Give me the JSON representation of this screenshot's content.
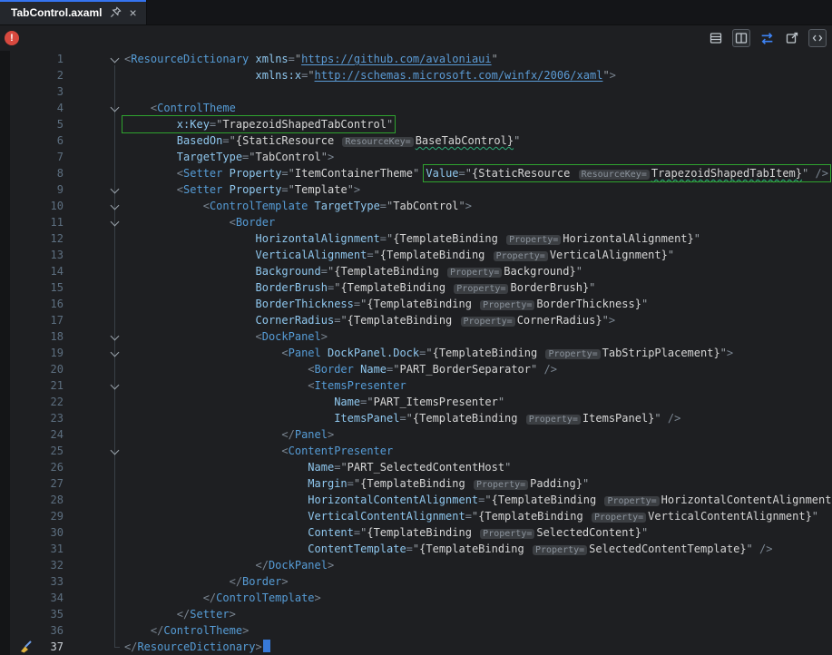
{
  "tab": {
    "title": "TabControl.axaml",
    "close_glyph": "×"
  },
  "toolbar": {
    "error_glyph": "!",
    "icons": [
      "structure-rows-icon",
      "split-vertical-icon",
      "swap-icon",
      "open-in-window-icon",
      "code-view-icon"
    ]
  },
  "colors": {
    "accent_blue": "#3574f0",
    "error_red": "#d8493f",
    "annotation_green": "#2fa32f",
    "element_blue": "#569cd6",
    "attribute_blue": "#8fc7ee"
  },
  "editor": {
    "language": "XAML",
    "caret_line": 37,
    "lines": [
      {
        "n": 1,
        "ind": 0,
        "fold": true,
        "t": [
          [
            "d",
            "<"
          ],
          [
            "e",
            "ResourceDictionary"
          ],
          [
            "v",
            " "
          ],
          [
            "a",
            "xmlns"
          ],
          [
            "d",
            "="
          ],
          [
            "q",
            "\""
          ],
          [
            "u",
            "https://github.com/avaloniaui"
          ],
          [
            "q",
            "\""
          ]
        ]
      },
      {
        "n": 2,
        "ind": 20,
        "t": [
          [
            "a",
            "xmlns:x"
          ],
          [
            "d",
            "="
          ],
          [
            "q",
            "\""
          ],
          [
            "u",
            "http://schemas.microsoft.com/winfx/2006/xaml"
          ],
          [
            "q",
            "\""
          ],
          [
            "d",
            ">"
          ]
        ]
      },
      {
        "n": 3,
        "ind": 0,
        "t": []
      },
      {
        "n": 4,
        "ind": 4,
        "fold": true,
        "t": [
          [
            "d",
            "<"
          ],
          [
            "e",
            "ControlTheme"
          ]
        ]
      },
      {
        "n": 5,
        "ind": 0,
        "t": [
          {
            "b": [
              [
                "v",
                "        "
              ],
              [
                "a",
                "x:Key"
              ],
              [
                "d",
                "="
              ],
              [
                "q",
                "\""
              ],
              [
                "v",
                "TrapezoidShapedTabControl"
              ],
              [
                "q",
                "\""
              ]
            ]
          }
        ]
      },
      {
        "n": 6,
        "ind": 8,
        "t": [
          [
            "a",
            "BasedOn"
          ],
          [
            "d",
            "="
          ],
          [
            "q",
            "\""
          ],
          [
            "v",
            "{StaticResource "
          ],
          [
            "h",
            "ResourceKey="
          ],
          [
            "w",
            "BaseTabControl}"
          ],
          [
            "q",
            "\""
          ]
        ]
      },
      {
        "n": 7,
        "ind": 8,
        "t": [
          [
            "a",
            "TargetType"
          ],
          [
            "d",
            "="
          ],
          [
            "q",
            "\""
          ],
          [
            "v",
            "TabControl"
          ],
          [
            "q",
            "\""
          ],
          [
            "d",
            ">"
          ]
        ]
      },
      {
        "n": 8,
        "ind": 8,
        "t": [
          [
            "d",
            "<"
          ],
          [
            "e",
            "Setter"
          ],
          [
            "v",
            " "
          ],
          [
            "a",
            "Property"
          ],
          [
            "d",
            "="
          ],
          [
            "q",
            "\""
          ],
          [
            "v",
            "ItemContainerTheme"
          ],
          [
            "q",
            "\""
          ],
          [
            "v",
            " "
          ],
          {
            "b": [
              [
                "a",
                "Value"
              ],
              [
                "d",
                "="
              ],
              [
                "q",
                "\""
              ],
              [
                "v",
                "{StaticResource "
              ],
              [
                "h",
                "ResourceKey="
              ],
              [
                "w",
                "TrapezoidShapedTabItem}"
              ],
              [
                "q",
                "\""
              ],
              [
                "v",
                " "
              ],
              [
                "d",
                "/>"
              ]
            ]
          }
        ]
      },
      {
        "n": 9,
        "ind": 8,
        "fold": true,
        "t": [
          [
            "d",
            "<"
          ],
          [
            "e",
            "Setter"
          ],
          [
            "v",
            " "
          ],
          [
            "a",
            "Property"
          ],
          [
            "d",
            "="
          ],
          [
            "q",
            "\""
          ],
          [
            "v",
            "Template"
          ],
          [
            "q",
            "\""
          ],
          [
            "d",
            ">"
          ]
        ]
      },
      {
        "n": 10,
        "ind": 12,
        "fold": true,
        "t": [
          [
            "d",
            "<"
          ],
          [
            "e",
            "ControlTemplate"
          ],
          [
            "v",
            " "
          ],
          [
            "a",
            "TargetType"
          ],
          [
            "d",
            "="
          ],
          [
            "q",
            "\""
          ],
          [
            "v",
            "TabControl"
          ],
          [
            "q",
            "\""
          ],
          [
            "d",
            ">"
          ]
        ]
      },
      {
        "n": 11,
        "ind": 16,
        "fold": true,
        "t": [
          [
            "d",
            "<"
          ],
          [
            "e",
            "Border"
          ]
        ]
      },
      {
        "n": 12,
        "ind": 20,
        "t": [
          [
            "a",
            "HorizontalAlignment"
          ],
          [
            "d",
            "="
          ],
          [
            "q",
            "\""
          ],
          [
            "v",
            "{TemplateBinding "
          ],
          [
            "h",
            "Property="
          ],
          [
            "v",
            "HorizontalAlignment}"
          ],
          [
            "q",
            "\""
          ]
        ]
      },
      {
        "n": 13,
        "ind": 20,
        "t": [
          [
            "a",
            "VerticalAlignment"
          ],
          [
            "d",
            "="
          ],
          [
            "q",
            "\""
          ],
          [
            "v",
            "{TemplateBinding "
          ],
          [
            "h",
            "Property="
          ],
          [
            "v",
            "VerticalAlignment}"
          ],
          [
            "q",
            "\""
          ]
        ]
      },
      {
        "n": 14,
        "ind": 20,
        "t": [
          [
            "a",
            "Background"
          ],
          [
            "d",
            "="
          ],
          [
            "q",
            "\""
          ],
          [
            "v",
            "{TemplateBinding "
          ],
          [
            "h",
            "Property="
          ],
          [
            "v",
            "Background}"
          ],
          [
            "q",
            "\""
          ]
        ]
      },
      {
        "n": 15,
        "ind": 20,
        "t": [
          [
            "a",
            "BorderBrush"
          ],
          [
            "d",
            "="
          ],
          [
            "q",
            "\""
          ],
          [
            "v",
            "{TemplateBinding "
          ],
          [
            "h",
            "Property="
          ],
          [
            "v",
            "BorderBrush}"
          ],
          [
            "q",
            "\""
          ]
        ]
      },
      {
        "n": 16,
        "ind": 20,
        "t": [
          [
            "a",
            "BorderThickness"
          ],
          [
            "d",
            "="
          ],
          [
            "q",
            "\""
          ],
          [
            "v",
            "{TemplateBinding "
          ],
          [
            "h",
            "Property="
          ],
          [
            "v",
            "BorderThickness}"
          ],
          [
            "q",
            "\""
          ]
        ]
      },
      {
        "n": 17,
        "ind": 20,
        "t": [
          [
            "a",
            "CornerRadius"
          ],
          [
            "d",
            "="
          ],
          [
            "q",
            "\""
          ],
          [
            "v",
            "{TemplateBinding "
          ],
          [
            "h",
            "Property="
          ],
          [
            "v",
            "CornerRadius}"
          ],
          [
            "q",
            "\""
          ],
          [
            "d",
            ">"
          ]
        ]
      },
      {
        "n": 18,
        "ind": 20,
        "fold": true,
        "t": [
          [
            "d",
            "<"
          ],
          [
            "e",
            "DockPanel"
          ],
          [
            "d",
            ">"
          ]
        ]
      },
      {
        "n": 19,
        "ind": 24,
        "fold": true,
        "t": [
          [
            "d",
            "<"
          ],
          [
            "e",
            "Panel"
          ],
          [
            "v",
            " "
          ],
          [
            "a",
            "DockPanel.Dock"
          ],
          [
            "d",
            "="
          ],
          [
            "q",
            "\""
          ],
          [
            "v",
            "{TemplateBinding "
          ],
          [
            "h",
            "Property="
          ],
          [
            "v",
            "TabStripPlacement}"
          ],
          [
            "q",
            "\""
          ],
          [
            "d",
            ">"
          ]
        ]
      },
      {
        "n": 20,
        "ind": 28,
        "t": [
          [
            "d",
            "<"
          ],
          [
            "e",
            "Border"
          ],
          [
            "v",
            " "
          ],
          [
            "a",
            "Name"
          ],
          [
            "d",
            "="
          ],
          [
            "q",
            "\""
          ],
          [
            "v",
            "PART_BorderSeparator"
          ],
          [
            "q",
            "\""
          ],
          [
            "v",
            " "
          ],
          [
            "d",
            "/>"
          ]
        ]
      },
      {
        "n": 21,
        "ind": 28,
        "fold": true,
        "t": [
          [
            "d",
            "<"
          ],
          [
            "e",
            "ItemsPresenter"
          ]
        ]
      },
      {
        "n": 22,
        "ind": 32,
        "t": [
          [
            "a",
            "Name"
          ],
          [
            "d",
            "="
          ],
          [
            "q",
            "\""
          ],
          [
            "v",
            "PART_ItemsPresenter"
          ],
          [
            "q",
            "\""
          ]
        ]
      },
      {
        "n": 23,
        "ind": 32,
        "t": [
          [
            "a",
            "ItemsPanel"
          ],
          [
            "d",
            "="
          ],
          [
            "q",
            "\""
          ],
          [
            "v",
            "{TemplateBinding "
          ],
          [
            "h",
            "Property="
          ],
          [
            "v",
            "ItemsPanel}"
          ],
          [
            "q",
            "\""
          ],
          [
            "v",
            " "
          ],
          [
            "d",
            "/>"
          ]
        ]
      },
      {
        "n": 24,
        "ind": 24,
        "t": [
          [
            "d",
            "</"
          ],
          [
            "e",
            "Panel"
          ],
          [
            "d",
            ">"
          ]
        ]
      },
      {
        "n": 25,
        "ind": 24,
        "fold": true,
        "t": [
          [
            "d",
            "<"
          ],
          [
            "e",
            "ContentPresenter"
          ]
        ]
      },
      {
        "n": 26,
        "ind": 28,
        "t": [
          [
            "a",
            "Name"
          ],
          [
            "d",
            "="
          ],
          [
            "q",
            "\""
          ],
          [
            "v",
            "PART_SelectedContentHost"
          ],
          [
            "q",
            "\""
          ]
        ]
      },
      {
        "n": 27,
        "ind": 28,
        "t": [
          [
            "a",
            "Margin"
          ],
          [
            "d",
            "="
          ],
          [
            "q",
            "\""
          ],
          [
            "v",
            "{TemplateBinding "
          ],
          [
            "h",
            "Property="
          ],
          [
            "v",
            "Padding}"
          ],
          [
            "q",
            "\""
          ]
        ]
      },
      {
        "n": 28,
        "ind": 28,
        "t": [
          [
            "a",
            "HorizontalContentAlignment"
          ],
          [
            "d",
            "="
          ],
          [
            "q",
            "\""
          ],
          [
            "v",
            "{TemplateBinding "
          ],
          [
            "h",
            "Property="
          ],
          [
            "v",
            "HorizontalContentAlignment}"
          ],
          [
            "q",
            "\""
          ]
        ]
      },
      {
        "n": 29,
        "ind": 28,
        "t": [
          [
            "a",
            "VerticalContentAlignment"
          ],
          [
            "d",
            "="
          ],
          [
            "q",
            "\""
          ],
          [
            "v",
            "{TemplateBinding "
          ],
          [
            "h",
            "Property="
          ],
          [
            "v",
            "VerticalContentAlignment}"
          ],
          [
            "q",
            "\""
          ]
        ]
      },
      {
        "n": 30,
        "ind": 28,
        "t": [
          [
            "a",
            "Content"
          ],
          [
            "d",
            "="
          ],
          [
            "q",
            "\""
          ],
          [
            "v",
            "{TemplateBinding "
          ],
          [
            "h",
            "Property="
          ],
          [
            "v",
            "SelectedContent}"
          ],
          [
            "q",
            "\""
          ]
        ]
      },
      {
        "n": 31,
        "ind": 28,
        "t": [
          [
            "a",
            "ContentTemplate"
          ],
          [
            "d",
            "="
          ],
          [
            "q",
            "\""
          ],
          [
            "v",
            "{TemplateBinding "
          ],
          [
            "h",
            "Property="
          ],
          [
            "v",
            "SelectedContentTemplate}"
          ],
          [
            "q",
            "\""
          ],
          [
            "v",
            " "
          ],
          [
            "d",
            "/>"
          ]
        ]
      },
      {
        "n": 32,
        "ind": 20,
        "t": [
          [
            "d",
            "</"
          ],
          [
            "e",
            "DockPanel"
          ],
          [
            "d",
            ">"
          ]
        ]
      },
      {
        "n": 33,
        "ind": 16,
        "t": [
          [
            "d",
            "</"
          ],
          [
            "e",
            "Border"
          ],
          [
            "d",
            ">"
          ]
        ]
      },
      {
        "n": 34,
        "ind": 12,
        "t": [
          [
            "d",
            "</"
          ],
          [
            "e",
            "ControlTemplate"
          ],
          [
            "d",
            ">"
          ]
        ]
      },
      {
        "n": 35,
        "ind": 8,
        "t": [
          [
            "d",
            "</"
          ],
          [
            "e",
            "Setter"
          ],
          [
            "d",
            ">"
          ]
        ]
      },
      {
        "n": 36,
        "ind": 4,
        "t": [
          [
            "d",
            "</"
          ],
          [
            "e",
            "ControlTheme"
          ],
          [
            "d",
            ">"
          ]
        ]
      },
      {
        "n": 37,
        "ind": 0,
        "cur": true,
        "t": [
          [
            "d",
            "</"
          ],
          [
            "e",
            "ResourceDictionary"
          ],
          [
            "d",
            ">"
          ],
          [
            "k",
            ""
          ]
        ]
      }
    ]
  }
}
